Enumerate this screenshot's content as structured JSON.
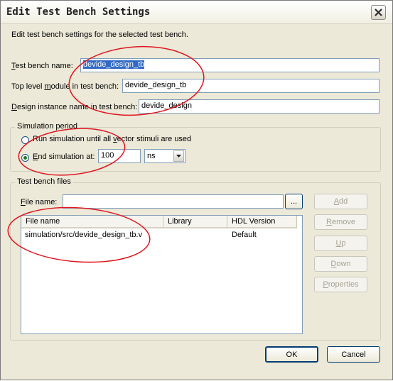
{
  "window": {
    "title": "Edit Test Bench Settings"
  },
  "description": "Edit test bench settings for the selected test bench.",
  "fields": {
    "tb_name": {
      "label_key": "T",
      "label_rest": "est bench name:",
      "value": "devide_design_tb"
    },
    "top_module": {
      "label_pre": "Top level ",
      "label_key": "m",
      "label_rest": "odule in test bench:",
      "value": "devide_design_tb"
    },
    "instance": {
      "label_key": "D",
      "label_rest": "esign instance name in test bench:",
      "value": "devide_design"
    }
  },
  "sim_period": {
    "group_title": "Simulation period",
    "run_all": {
      "pre": "Run simulation until all ",
      "key": "v",
      "rest": "ector stimuli are used",
      "selected": false
    },
    "end_at": {
      "key": "E",
      "rest": "nd simulation at:",
      "selected": true
    },
    "time_value": "100",
    "unit": "ns"
  },
  "files": {
    "group_title": "Test bench files",
    "file_label_key": "F",
    "file_label_rest": "ile name:",
    "file_value": "",
    "browse": "...",
    "columns": [
      "File name",
      "Library",
      "HDL Version"
    ],
    "rows": [
      {
        "file": "simulation/src/devide_design_tb.v",
        "library": "",
        "hdl": "Default"
      }
    ]
  },
  "side_buttons": [
    {
      "key": "A",
      "rest": "dd",
      "enabled": false
    },
    {
      "key": "R",
      "rest": "emove",
      "enabled": false
    },
    {
      "key": "U",
      "rest": "p",
      "enabled": false
    },
    {
      "key": "D",
      "rest": "own",
      "enabled": false
    },
    {
      "key": "P",
      "rest": "roperties",
      "enabled": false
    }
  ],
  "footer": {
    "ok": "OK",
    "cancel": "Cancel"
  },
  "colors": {
    "dialog_bg": "#ece9d8",
    "selection": "#316ac5",
    "annotation": "#e0141e"
  }
}
